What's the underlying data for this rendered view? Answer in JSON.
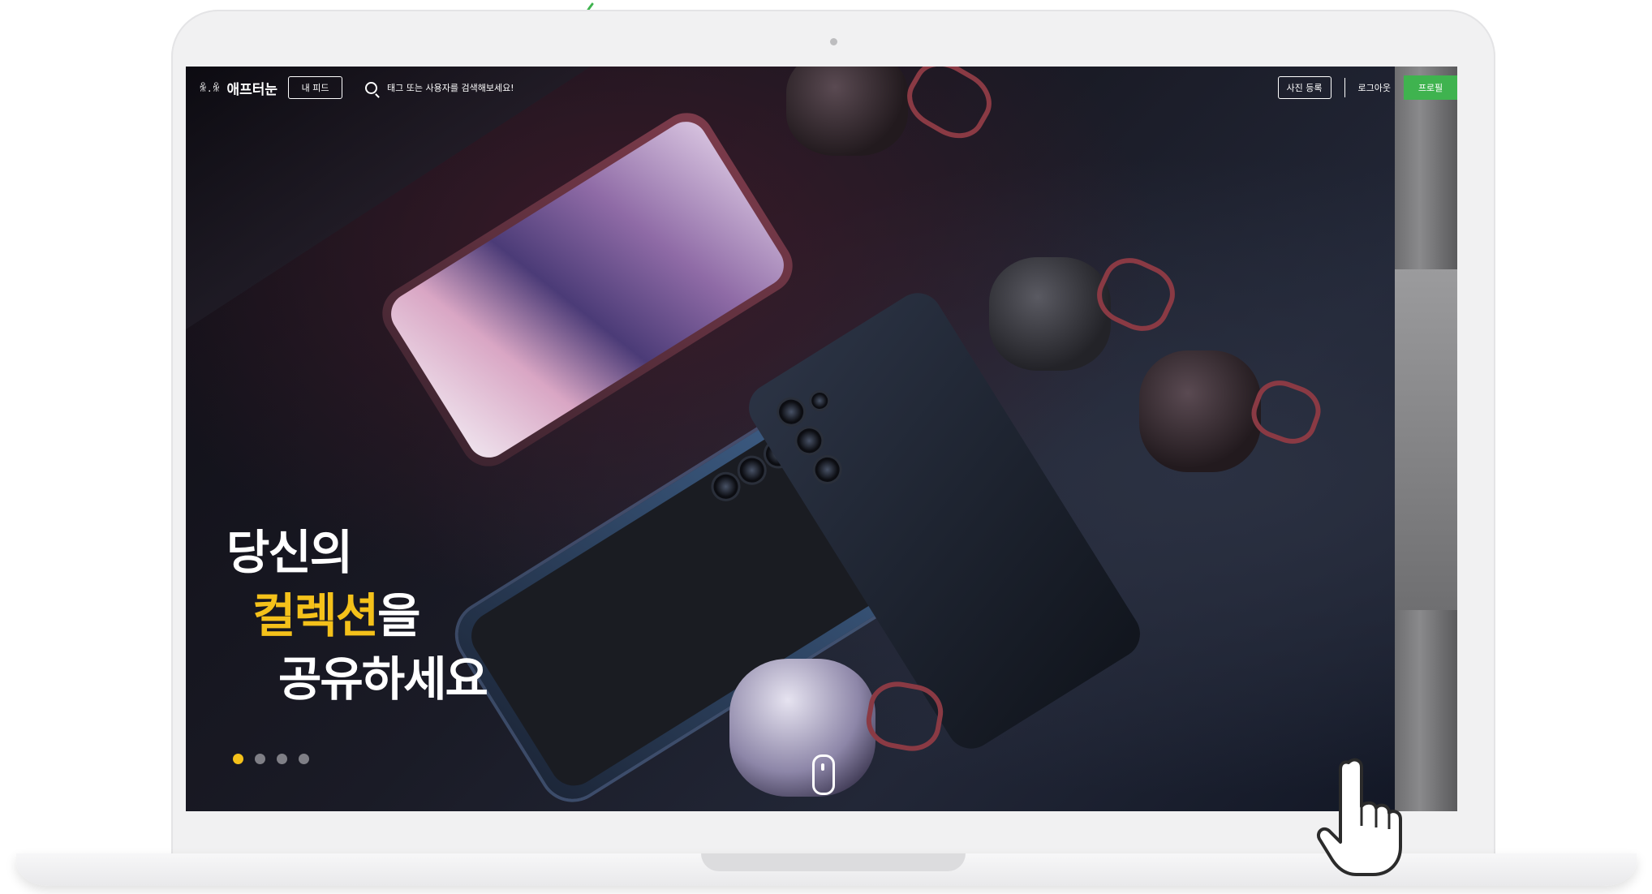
{
  "header": {
    "logo_mark": "ꆜ.ꆜ",
    "logo_text": "애프터눈",
    "feed_label": "내 피드",
    "search_placeholder": "태그 또는 사용자를 검색해보세요!",
    "upload_label": "사진 등록",
    "logout_label": "로그아웃",
    "profile_label": "프로필"
  },
  "hero": {
    "line1": "당신의",
    "line2_accent": "컬렉션",
    "line2_rest": "을",
    "line3": "공유하세요"
  },
  "slider": {
    "total": 4,
    "active_index": 0
  },
  "colors": {
    "accent_yellow": "#f4c11a",
    "profile_green": "#3fb34f"
  },
  "icons": {
    "search": "search-icon",
    "scroll": "scroll-mouse-icon",
    "pointer": "hand-pointer-icon"
  }
}
